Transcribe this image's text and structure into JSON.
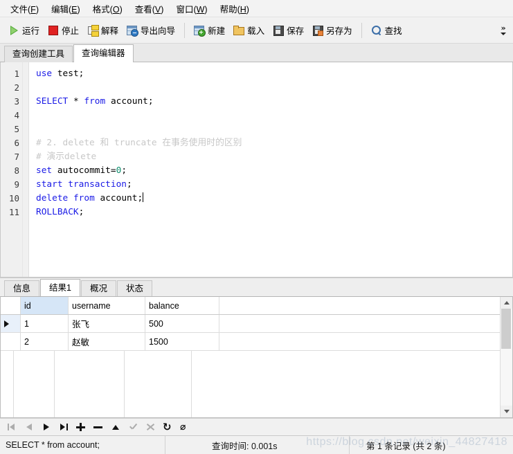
{
  "menubar": {
    "items": [
      {
        "name": "file",
        "label": "文件",
        "accel": "F"
      },
      {
        "name": "edit",
        "label": "编辑",
        "accel": "E"
      },
      {
        "name": "format",
        "label": "格式",
        "accel": "O"
      },
      {
        "name": "view",
        "label": "查看",
        "accel": "V"
      },
      {
        "name": "window",
        "label": "窗口",
        "accel": "W"
      },
      {
        "name": "help",
        "label": "帮助",
        "accel": "H"
      }
    ]
  },
  "toolbar": {
    "run_label": "运行",
    "stop_label": "停止",
    "explain_label": "解释",
    "export_wizard_label": "导出向导",
    "new_label": "新建",
    "load_label": "载入",
    "save_label": "保存",
    "save_as_label": "另存为",
    "find_label": "查找",
    "overflow_label": "»"
  },
  "editor_tabs": [
    {
      "name": "query-builder",
      "label": "查询创建工具",
      "active": false
    },
    {
      "name": "query-editor",
      "label": "查询编辑器",
      "active": true
    }
  ],
  "editor": {
    "line_numbers": [
      "1",
      "2",
      "3",
      "4",
      "5",
      "6",
      "7",
      "8",
      "9",
      "10",
      "11"
    ],
    "lines": [
      {
        "n": 1,
        "tokens": [
          {
            "t": "use",
            "c": "kw"
          },
          {
            "t": " ",
            "c": "op"
          },
          {
            "t": "test",
            "c": "id"
          },
          {
            "t": ";",
            "c": "op"
          }
        ]
      },
      {
        "n": 2,
        "tokens": []
      },
      {
        "n": 3,
        "tokens": [
          {
            "t": "SELECT",
            "c": "kw"
          },
          {
            "t": " ",
            "c": "op"
          },
          {
            "t": "*",
            "c": "op"
          },
          {
            "t": " ",
            "c": "op"
          },
          {
            "t": "from",
            "c": "kw"
          },
          {
            "t": " ",
            "c": "op"
          },
          {
            "t": "account",
            "c": "id"
          },
          {
            "t": ";",
            "c": "op"
          }
        ]
      },
      {
        "n": 4,
        "tokens": []
      },
      {
        "n": 5,
        "tokens": []
      },
      {
        "n": 6,
        "tokens": [
          {
            "t": "# 2. delete 和 truncate 在事务使用时的区别",
            "c": "cmt"
          }
        ]
      },
      {
        "n": 7,
        "tokens": [
          {
            "t": "# 演示delete",
            "c": "cmt"
          }
        ]
      },
      {
        "n": 8,
        "tokens": [
          {
            "t": "set",
            "c": "kw"
          },
          {
            "t": " ",
            "c": "op"
          },
          {
            "t": "autocommit",
            "c": "id"
          },
          {
            "t": "=",
            "c": "op"
          },
          {
            "t": "0",
            "c": "num"
          },
          {
            "t": ";",
            "c": "op"
          }
        ]
      },
      {
        "n": 9,
        "tokens": [
          {
            "t": "start",
            "c": "kw"
          },
          {
            "t": " ",
            "c": "op"
          },
          {
            "t": "transaction",
            "c": "kw"
          },
          {
            "t": ";",
            "c": "op"
          }
        ]
      },
      {
        "n": 10,
        "tokens": [
          {
            "t": "delete",
            "c": "kw"
          },
          {
            "t": " ",
            "c": "op"
          },
          {
            "t": "from",
            "c": "kw"
          },
          {
            "t": " ",
            "c": "op"
          },
          {
            "t": "account",
            "c": "id"
          },
          {
            "t": ";",
            "c": "op"
          }
        ],
        "caret": true
      },
      {
        "n": 11,
        "tokens": [
          {
            "t": "ROLLBACK",
            "c": "kw"
          },
          {
            "t": ";",
            "c": "op"
          }
        ]
      }
    ]
  },
  "result_tabs": [
    {
      "name": "info",
      "label": "信息",
      "active": false
    },
    {
      "name": "result1",
      "label": "结果1",
      "active": true
    },
    {
      "name": "profile",
      "label": "概况",
      "active": false
    },
    {
      "name": "status",
      "label": "状态",
      "active": false
    }
  ],
  "grid": {
    "columns": [
      "id",
      "username",
      "balance"
    ],
    "selected_column": "id",
    "rows": [
      {
        "current": true,
        "id": "1",
        "username": "张飞",
        "balance": "500"
      },
      {
        "current": false,
        "id": "2",
        "username": "赵敏",
        "balance": "1500"
      }
    ]
  },
  "record_nav": [
    {
      "name": "first-record",
      "glyph": "first",
      "disabled": true
    },
    {
      "name": "prev-record",
      "glyph": "prev",
      "disabled": true
    },
    {
      "name": "next-record",
      "glyph": "next",
      "disabled": false
    },
    {
      "name": "last-record",
      "glyph": "last",
      "disabled": false
    },
    {
      "name": "add-record",
      "glyph": "plus",
      "disabled": false
    },
    {
      "name": "delete-record",
      "glyph": "minus",
      "disabled": false
    },
    {
      "name": "edit-record",
      "glyph": "up",
      "disabled": false
    },
    {
      "name": "confirm-edit",
      "glyph": "check",
      "disabled": true
    },
    {
      "name": "cancel-edit",
      "glyph": "cross",
      "disabled": true
    },
    {
      "name": "refresh",
      "glyph": "refresh",
      "disabled": false
    },
    {
      "name": "stop-loading",
      "glyph": "stop",
      "disabled": false
    }
  ],
  "statusbar": {
    "sql": "SELECT * from account;",
    "query_time": "查询时间: 0.001s",
    "record_info": "第 1 条记录 (共 2 条)",
    "watermark": "https://blog.csdn.net/weixin_44827418"
  }
}
